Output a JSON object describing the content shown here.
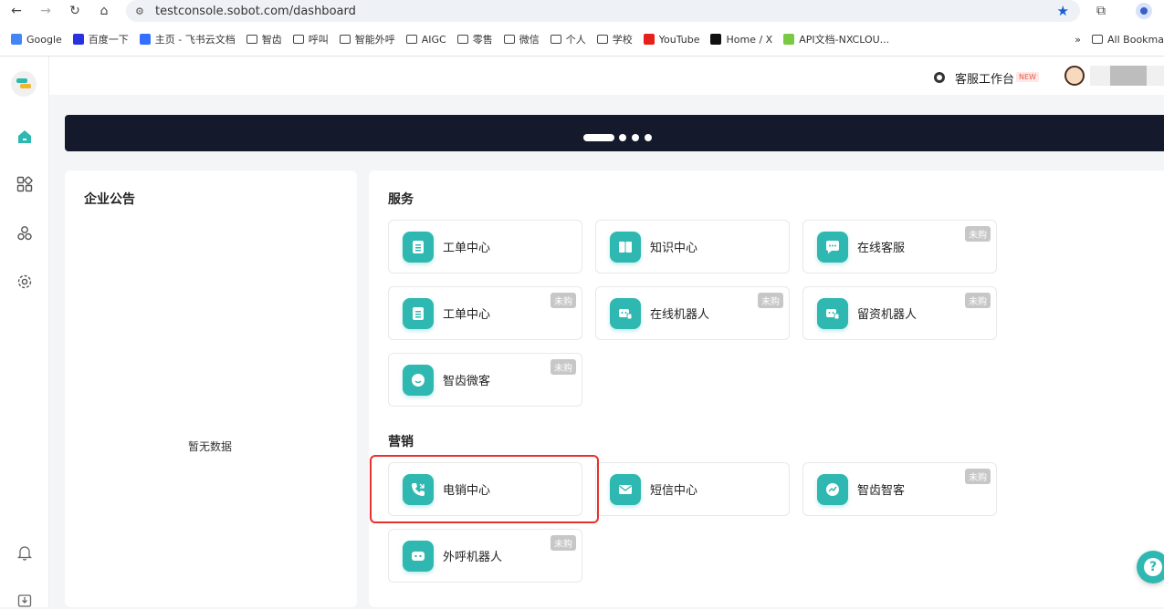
{
  "browser": {
    "url": "testconsole.sobot.com/dashboard",
    "bookmarks": [
      {
        "label": "Google",
        "icon": "google-icon"
      },
      {
        "label": "百度一下",
        "icon": "baidu-icon"
      },
      {
        "label": "主页 - 飞书云文档",
        "icon": "feishu-icon"
      },
      {
        "label": "智齿",
        "icon": "folder-icon"
      },
      {
        "label": "呼叫",
        "icon": "folder-icon"
      },
      {
        "label": "智能外呼",
        "icon": "folder-icon"
      },
      {
        "label": "AIGC",
        "icon": "folder-icon"
      },
      {
        "label": "零售",
        "icon": "folder-icon"
      },
      {
        "label": "微信",
        "icon": "folder-icon"
      },
      {
        "label": "个人",
        "icon": "folder-icon"
      },
      {
        "label": "学校",
        "icon": "folder-icon"
      },
      {
        "label": "YouTube",
        "icon": "youtube-icon"
      },
      {
        "label": "Home / X",
        "icon": "x-icon"
      },
      {
        "label": "API文档-NXCLOU...",
        "icon": "nx-icon"
      }
    ],
    "more": "»",
    "all_bookmarks": "All Bookma"
  },
  "header": {
    "workbench": "客服工作台",
    "new_badge": "NEW"
  },
  "announcement": {
    "title": "企业公告",
    "empty": "暂无数据"
  },
  "services": {
    "title": "服务",
    "cards": [
      {
        "label": "工单中心",
        "badge": ""
      },
      {
        "label": "知识中心",
        "badge": ""
      },
      {
        "label": "在线客服",
        "badge": "未购"
      },
      {
        "label": "工单中心",
        "badge": "未购"
      },
      {
        "label": "在线机器人",
        "badge": "未购"
      },
      {
        "label": "留资机器人",
        "badge": "未购"
      },
      {
        "label": "智齿微客",
        "badge": "未购"
      }
    ]
  },
  "marketing": {
    "title": "营销",
    "cards": [
      {
        "label": "电销中心",
        "badge": ""
      },
      {
        "label": "短信中心",
        "badge": ""
      },
      {
        "label": "智齿智客",
        "badge": "未购"
      },
      {
        "label": "外呼机器人",
        "badge": "未购"
      }
    ]
  },
  "help": "?",
  "colors": {
    "accent": "#2fb8b1",
    "highlight": "#e8302c",
    "banner": "#141a2c"
  }
}
